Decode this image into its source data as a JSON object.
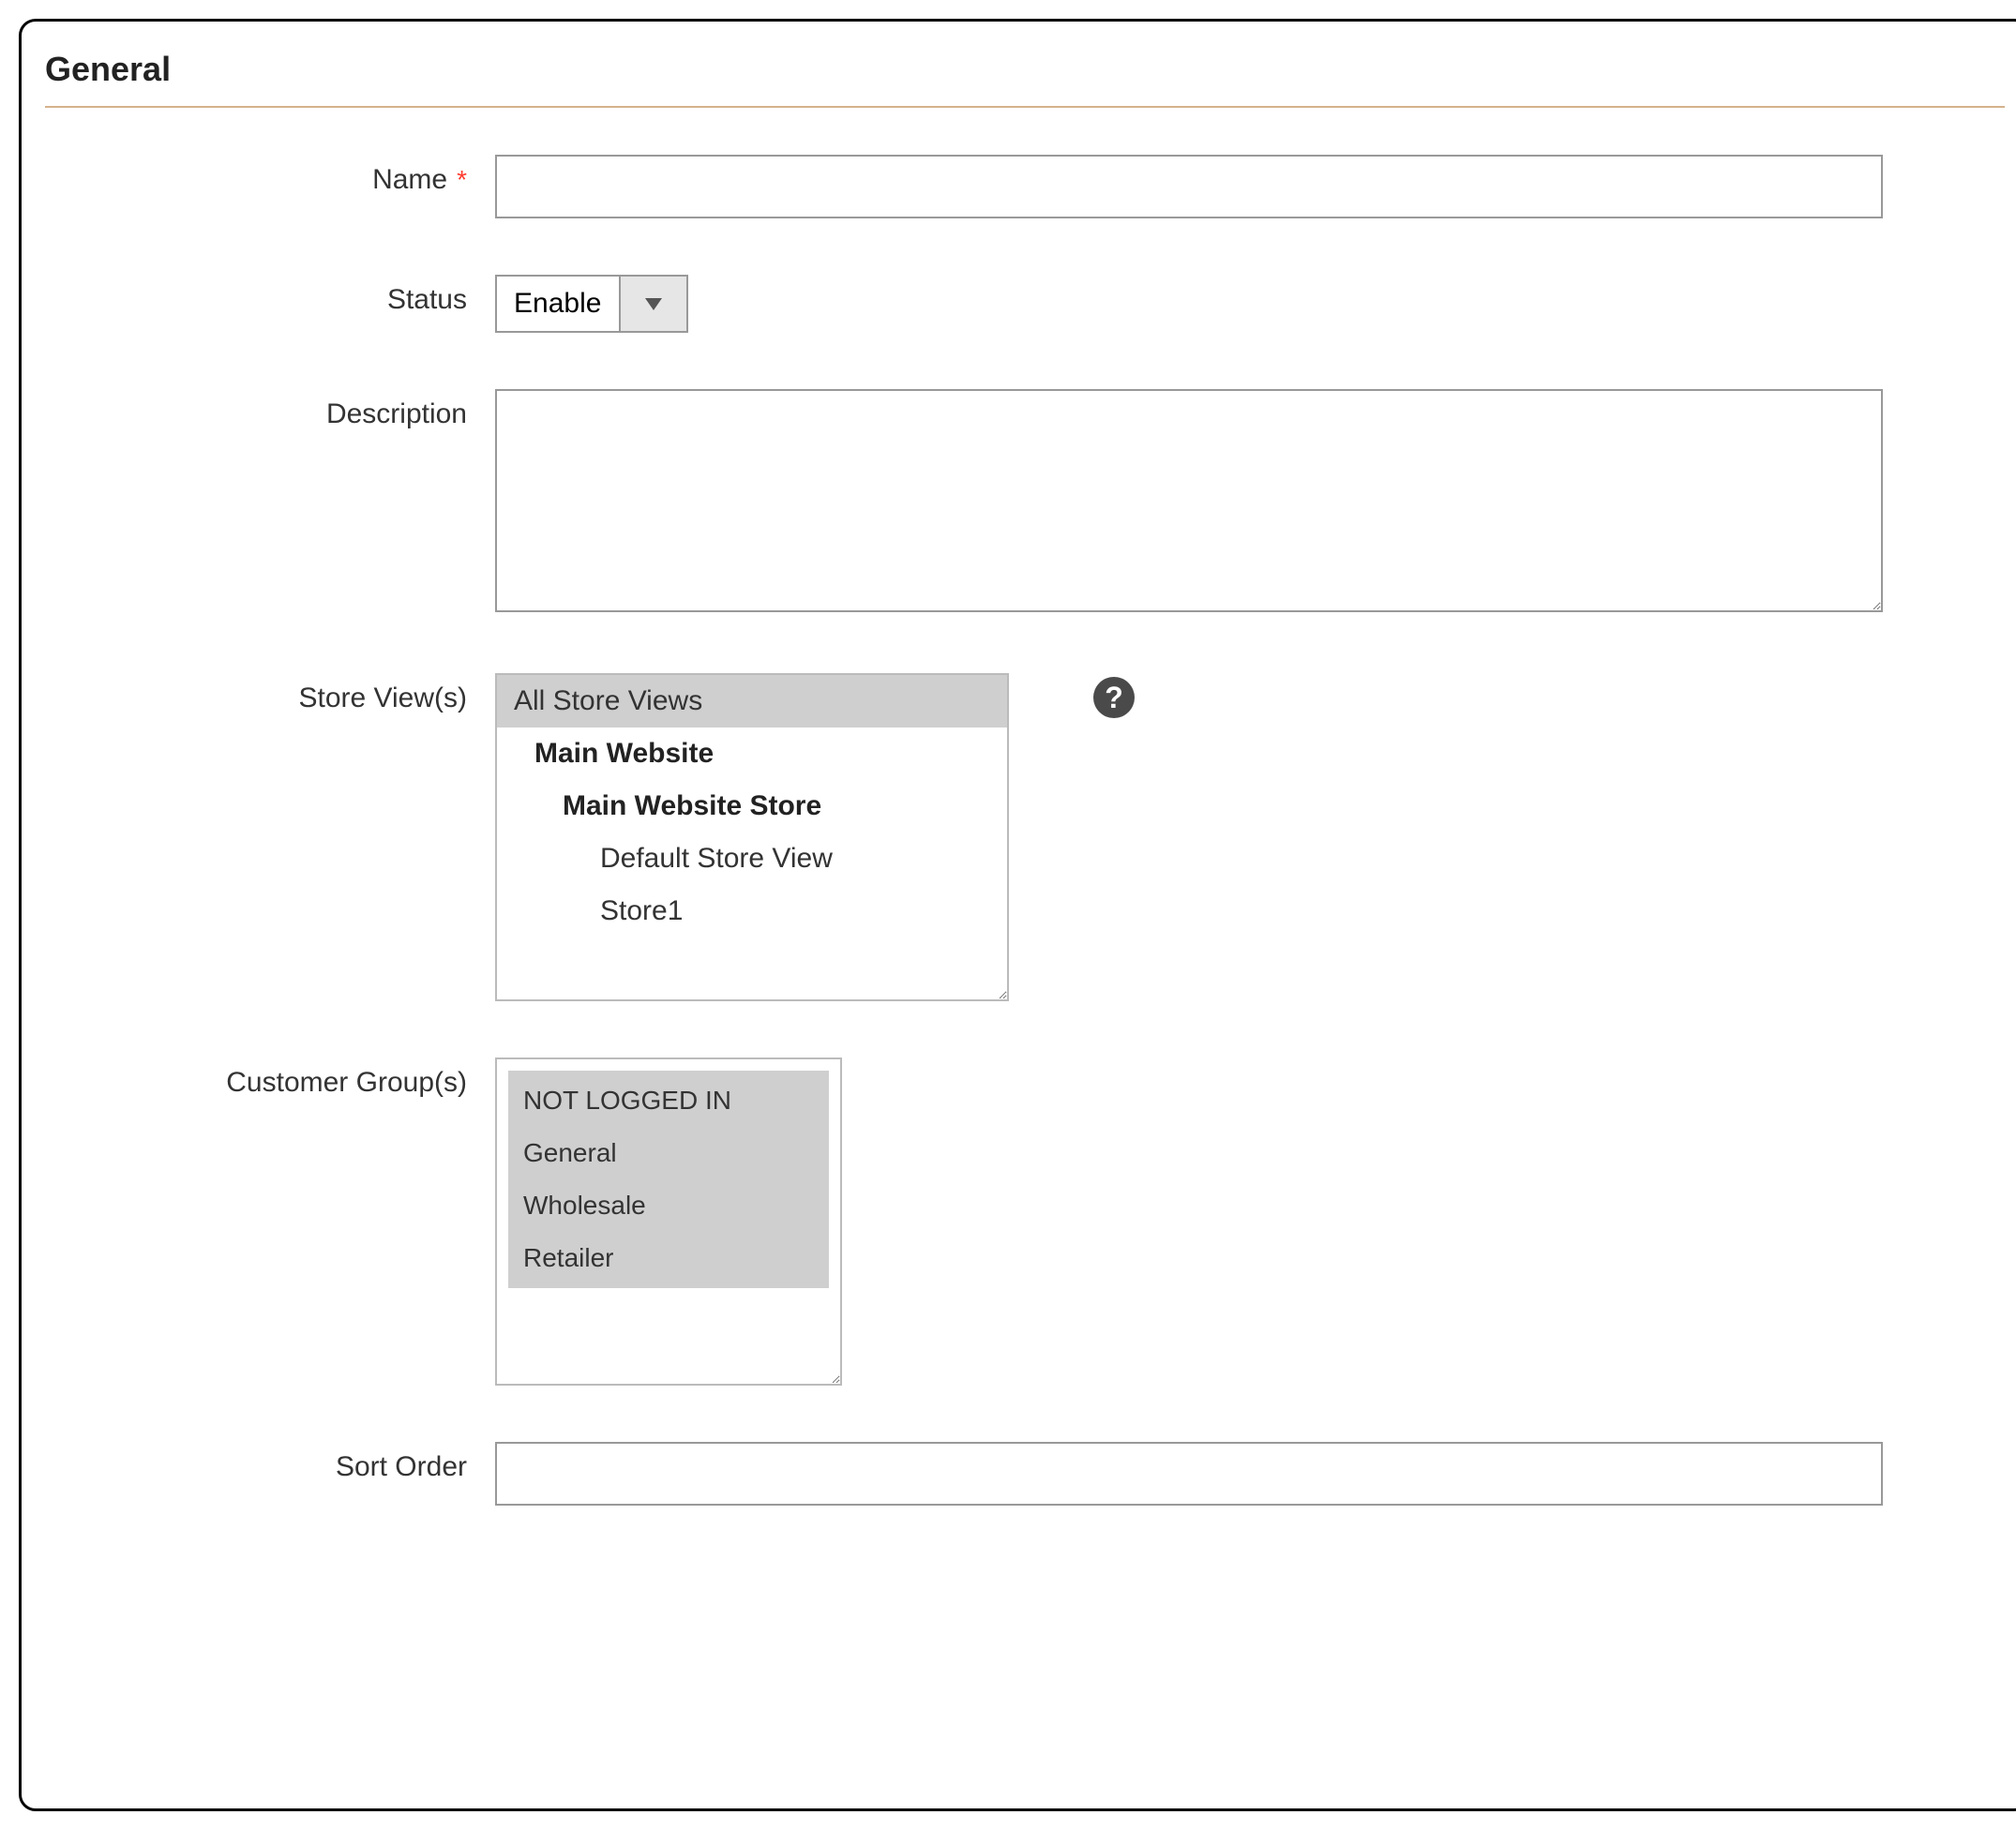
{
  "section": {
    "title": "General"
  },
  "fields": {
    "name": {
      "label": "Name",
      "value": "",
      "required": true
    },
    "status": {
      "label": "Status",
      "selected": "Enable"
    },
    "description": {
      "label": "Description",
      "value": ""
    },
    "store_views": {
      "label": "Store View(s)",
      "options": [
        {
          "label": "All Store Views",
          "indent": 0,
          "bold": false,
          "selected": true
        },
        {
          "label": "Main Website",
          "indent": 1,
          "bold": true,
          "selected": false
        },
        {
          "label": "Main Website Store",
          "indent": 2,
          "bold": true,
          "selected": false
        },
        {
          "label": "Default Store View",
          "indent": 3,
          "bold": false,
          "selected": false
        },
        {
          "label": "Store1",
          "indent": 3,
          "bold": false,
          "selected": false
        }
      ]
    },
    "customer_groups": {
      "label": "Customer Group(s)",
      "options": [
        {
          "label": "NOT LOGGED IN"
        },
        {
          "label": "General"
        },
        {
          "label": "Wholesale"
        },
        {
          "label": "Retailer"
        }
      ]
    },
    "sort_order": {
      "label": "Sort Order",
      "value": ""
    }
  },
  "icons": {
    "help": "?"
  }
}
